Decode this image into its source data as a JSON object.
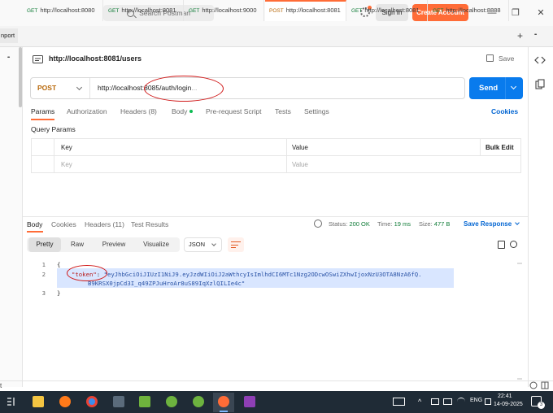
{
  "window": {
    "search_placeholder": "Search Postman",
    "signin_label": "Sign In",
    "create_account_label": "Create Account",
    "minimize_glyph": "—",
    "maximize_glyph": "❐",
    "close_glyph": "✕"
  },
  "tabs": {
    "import_label": "nport",
    "items": [
      {
        "method": "GET",
        "url": "http://localhost:8080"
      },
      {
        "method": "GET",
        "url": "http://localhost:8081"
      },
      {
        "method": "GET",
        "url": "http://localhost:9000"
      },
      {
        "method": "POST",
        "url": "http://localhost:8081"
      },
      {
        "method": "GET",
        "url": "http://localhost:8081"
      },
      {
        "method": "GET",
        "url": "http://localhost:8888"
      }
    ],
    "add_glyph": "+",
    "more_glyph": "•••"
  },
  "request": {
    "title": "http://localhost:8081/users",
    "save_label": "Save",
    "method": "POST",
    "url": "http://localhost:8085/auth/login",
    "url_suffix": "...",
    "send_label": "Send",
    "tabs": {
      "params": "Params",
      "authorization": "Authorization",
      "headers": "Headers (8)",
      "body": "Body",
      "prerequest": "Pre-request Script",
      "tests": "Tests",
      "settings": "Settings"
    },
    "cookies_label": "Cookies",
    "query_params_title": "Query Params",
    "params_table": {
      "col_key": "Key",
      "col_value": "Value",
      "bulk_edit": "Bulk Edit",
      "key_placeholder": "Key",
      "value_placeholder": "Value"
    }
  },
  "response": {
    "tabs": {
      "body": "Body",
      "cookies": "Cookies",
      "headers": "Headers (11)",
      "test_results": "Test Results"
    },
    "status_label": "Status:",
    "status_value": "200 OK",
    "time_label": "Time:",
    "time_value": "19 ms",
    "size_label": "Size:",
    "size_value": "477 B",
    "save_response_label": "Save Response",
    "formats": {
      "pretty": "Pretty",
      "raw": "Raw",
      "preview": "Preview",
      "visualize": "Visualize"
    },
    "language": "JSON",
    "code": {
      "line1_no": "1",
      "line2_no": "2",
      "line3_no": "3",
      "open_brace": "{",
      "close_brace": "}",
      "key": "\"token\"",
      "colon": ": ",
      "value_part1": "\"eyJhbGciOiJIUzI1NiJ9.eyJzdWIiOiJ2aWthcyIsImlhdCI6MTc1Nzg2ODcwOSwiZXhwIjoxNzU3OTA8NzA6fQ.",
      "value_part2": "B9KRSX0jpCd3I_q49ZPJuHroAr8uS89IqXzlQILIe4c\""
    }
  },
  "taskbar": {
    "lang": "ENG",
    "time": "22:41",
    "date": "14-09-2025",
    "notification_count": "3"
  },
  "colors": {
    "accent": "#ff6c37",
    "send_blue": "#097bed",
    "link_blue": "#0265d2",
    "status_green": "#0f7b37",
    "annotation_red": "#d01818"
  }
}
